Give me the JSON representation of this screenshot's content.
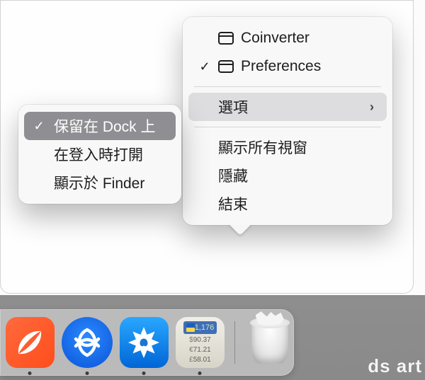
{
  "main_menu": {
    "windows": [
      {
        "label": "Coinverter",
        "checked": false
      },
      {
        "label": "Preferences",
        "checked": true
      }
    ],
    "options_label": "選項",
    "show_all_windows": "顯示所有視窗",
    "hide": "隱藏",
    "quit": "結束"
  },
  "sub_menu": {
    "keep_in_dock": "保留在 Dock 上",
    "open_at_login": "在登入時打開",
    "show_in_finder": "顯示於 Finder"
  },
  "dock": {
    "app_widget": {
      "top_value": "1,176",
      "rows": [
        {
          "sym": "$",
          "val": "90.37"
        },
        {
          "sym": "€",
          "val": "71.21"
        },
        {
          "sym": "£",
          "val": "58.01"
        }
      ]
    }
  },
  "bg_text": "ds art"
}
